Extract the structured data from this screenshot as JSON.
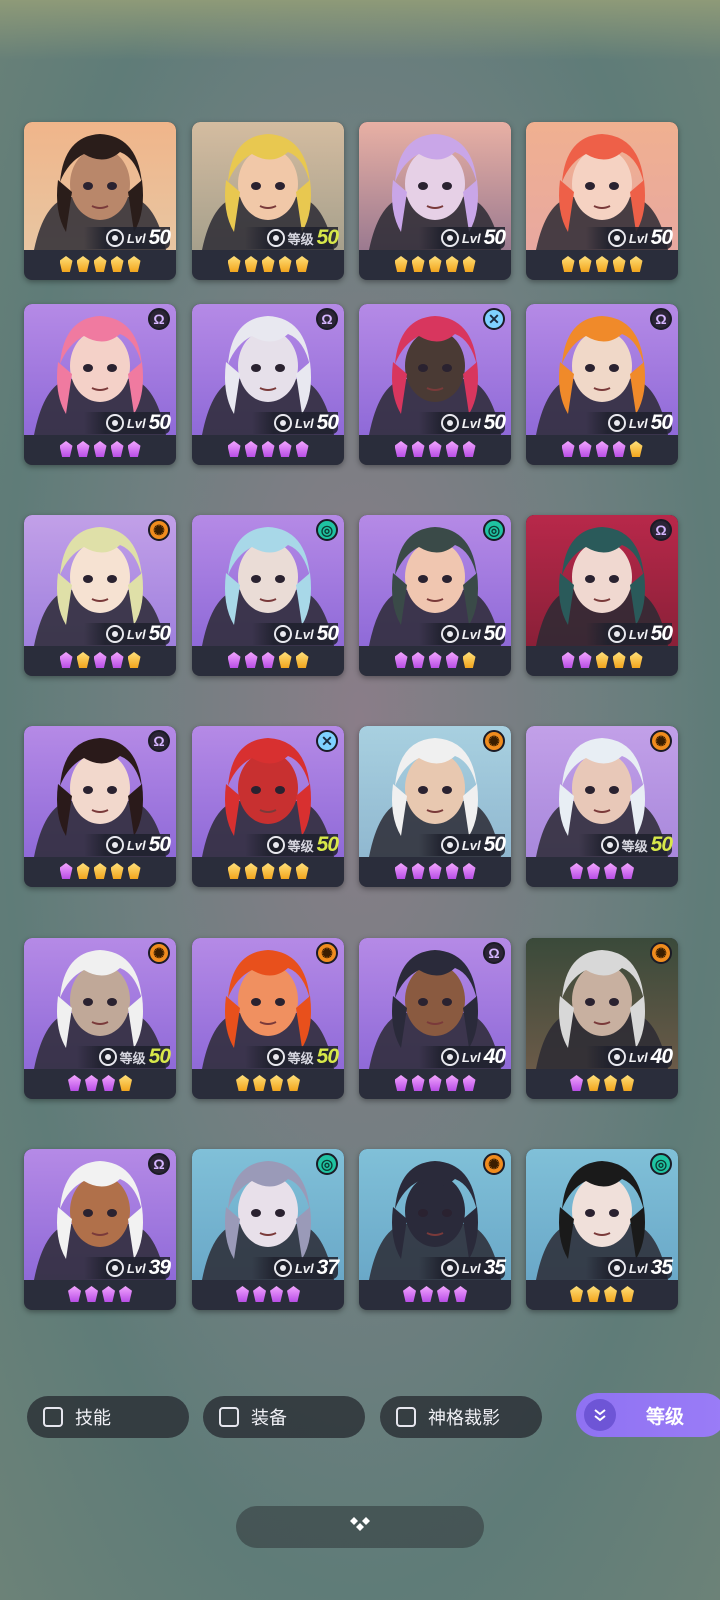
{
  "heroes": [
    {
      "lvl_prefix": "Lvl",
      "level": "50",
      "gold": false,
      "badge": "",
      "gems": [
        "gold",
        "gold",
        "gold",
        "gold",
        "gold"
      ],
      "bg": [
        "#f0b58a",
        "#e8c6a2"
      ],
      "hair": "#2a1d1a",
      "skin": "#b9876a"
    },
    {
      "lvl_prefix": "等级",
      "level": "50",
      "gold": true,
      "badge": "",
      "gems": [
        "gold",
        "gold",
        "gold",
        "gold",
        "gold"
      ],
      "bg": [
        "#d4bca0",
        "#a6a08c"
      ],
      "hair": "#e8c850",
      "skin": "#f1c8a8"
    },
    {
      "lvl_prefix": "Lvl",
      "level": "50",
      "gold": false,
      "badge": "",
      "gems": [
        "gold",
        "gold",
        "gold",
        "gold",
        "gold"
      ],
      "bg": [
        "#e8b0a4",
        "#9b7a90"
      ],
      "hair": "#c9a6e8",
      "skin": "#e6d0e6"
    },
    {
      "lvl_prefix": "Lvl",
      "level": "50",
      "gold": false,
      "badge": "",
      "gems": [
        "gold",
        "gold",
        "gold",
        "gold",
        "gold"
      ],
      "bg": [
        "#f0b090",
        "#e8a8a0"
      ],
      "hair": "#ee6048",
      "skin": "#f5d2c2"
    },
    {
      "lvl_prefix": "Lvl",
      "level": "50",
      "gold": false,
      "badge": "omega-icon",
      "gems": [
        "purple",
        "purple",
        "purple",
        "purple",
        "purple"
      ],
      "bg": [
        "#b58ae6",
        "#8f6ad8"
      ],
      "hair": "#f07aa0",
      "skin": "#f4d1c8"
    },
    {
      "lvl_prefix": "Lvl",
      "level": "50",
      "gold": false,
      "badge": "omega-icon",
      "gems": [
        "purple",
        "purple",
        "purple",
        "purple",
        "purple"
      ],
      "bg": [
        "#b58ae6",
        "#8f6ad8"
      ],
      "hair": "#e8e8f0",
      "skin": "#e6e0ea"
    },
    {
      "lvl_prefix": "Lvl",
      "level": "50",
      "gold": false,
      "badge": "x-icon",
      "gems": [
        "purple",
        "purple",
        "purple",
        "purple",
        "purple"
      ],
      "bg": [
        "#b58ae6",
        "#8f6ad8"
      ],
      "hair": "#d8365e",
      "skin": "#4a3a34"
    },
    {
      "lvl_prefix": "Lvl",
      "level": "50",
      "gold": false,
      "badge": "omega-icon",
      "gems": [
        "purple",
        "purple",
        "purple",
        "purple",
        "gold"
      ],
      "bg": [
        "#b58ae6",
        "#8f6ad8"
      ],
      "hair": "#f08a2a",
      "skin": "#f0d8c8"
    },
    {
      "lvl_prefix": "Lvl",
      "level": "50",
      "gold": false,
      "badge": "sun-icon",
      "gems": [
        "purple",
        "gold",
        "purple",
        "purple",
        "gold"
      ],
      "bg": [
        "#c2a0e8",
        "#9f80de"
      ],
      "hair": "#dfe0a8",
      "skin": "#f6e2d2"
    },
    {
      "lvl_prefix": "Lvl",
      "level": "50",
      "gold": false,
      "badge": "spiral-icon",
      "gems": [
        "purple",
        "purple",
        "purple",
        "gold",
        "gold"
      ],
      "bg": [
        "#b58ae6",
        "#8f6ad8"
      ],
      "hair": "#a8d8e8",
      "skin": "#eadcd6"
    },
    {
      "lvl_prefix": "Lvl",
      "level": "50",
      "gold": false,
      "badge": "spiral-icon",
      "gems": [
        "purple",
        "purple",
        "purple",
        "purple",
        "gold"
      ],
      "bg": [
        "#b58ae6",
        "#8f6ad8"
      ],
      "hair": "#3a4a48",
      "skin": "#f0c6b0"
    },
    {
      "lvl_prefix": "Lvl",
      "level": "50",
      "gold": false,
      "badge": "omega-icon",
      "gems": [
        "purple",
        "purple",
        "gold",
        "gold",
        "gold"
      ],
      "bg": [
        "#b8284a",
        "#8a2038"
      ],
      "hair": "#2a5a5a",
      "skin": "#f0d8d0"
    },
    {
      "lvl_prefix": "Lvl",
      "level": "50",
      "gold": false,
      "badge": "omega-icon",
      "gems": [
        "purple",
        "gold",
        "gold",
        "gold",
        "gold"
      ],
      "bg": [
        "#b58ae6",
        "#8f6ad8"
      ],
      "hair": "#2a1a1a",
      "skin": "#f2d8cc"
    },
    {
      "lvl_prefix": "等级",
      "level": "50",
      "gold": true,
      "badge": "x-icon",
      "gems": [
        "gold",
        "gold",
        "gold",
        "gold",
        "gold"
      ],
      "bg": [
        "#b58ae6",
        "#8f6ad8"
      ],
      "hair": "#d83030",
      "skin": "#c83030"
    },
    {
      "lvl_prefix": "Lvl",
      "level": "50",
      "gold": false,
      "badge": "sun-icon",
      "gems": [
        "purple",
        "purple",
        "purple",
        "purple",
        "purple"
      ],
      "bg": [
        "#a8d0e0",
        "#90b8d0"
      ],
      "hair": "#f0f0f0",
      "skin": "#e8c8b0"
    },
    {
      "lvl_prefix": "等级",
      "level": "50",
      "gold": true,
      "badge": "sun-icon",
      "gems": [
        "purple",
        "purple",
        "purple",
        "purple"
      ],
      "bg": [
        "#c2a0e8",
        "#a888dc"
      ],
      "hair": "#e8eef4",
      "skin": "#e8c8b8"
    },
    {
      "lvl_prefix": "等级",
      "level": "50",
      "gold": true,
      "badge": "sun-icon",
      "gems": [
        "purple",
        "purple",
        "purple",
        "gold"
      ],
      "bg": [
        "#b58ae6",
        "#8f6ad8"
      ],
      "hair": "#f0f0f0",
      "skin": "#c0a898"
    },
    {
      "lvl_prefix": "等级",
      "level": "50",
      "gold": true,
      "badge": "sun-icon",
      "gems": [
        "gold",
        "gold",
        "gold",
        "gold"
      ],
      "bg": [
        "#b58ae6",
        "#8f6ad8"
      ],
      "hair": "#e8501c",
      "skin": "#f09060"
    },
    {
      "lvl_prefix": "Lvl",
      "level": "40",
      "gold": false,
      "badge": "omega-icon",
      "gems": [
        "purple",
        "purple",
        "purple",
        "purple",
        "purple"
      ],
      "bg": [
        "#b58ae6",
        "#8f6ad8"
      ],
      "hair": "#2a2a3a",
      "skin": "#8a5a40"
    },
    {
      "lvl_prefix": "Lvl",
      "level": "40",
      "gold": false,
      "badge": "sun-icon",
      "gems": [
        "purple",
        "gold",
        "gold",
        "gold"
      ],
      "bg": [
        "#3a4a3a",
        "#6a5a48"
      ],
      "hair": "#d8d8d8",
      "skin": "#c8b0a0"
    },
    {
      "lvl_prefix": "Lvl",
      "level": "39",
      "gold": false,
      "badge": "omega-icon",
      "gems": [
        "purple",
        "purple",
        "purple",
        "purple"
      ],
      "bg": [
        "#b58ae6",
        "#8f6ad8"
      ],
      "hair": "#f2f2f2",
      "skin": "#b0704a"
    },
    {
      "lvl_prefix": "Lvl",
      "level": "37",
      "gold": false,
      "badge": "spiral-icon",
      "gems": [
        "purple",
        "purple",
        "purple",
        "purple"
      ],
      "bg": [
        "#80c0d8",
        "#6aa8c8"
      ],
      "hair": "#9a9ab8",
      "skin": "#e8e0ea"
    },
    {
      "lvl_prefix": "Lvl",
      "level": "35",
      "gold": false,
      "badge": "sun-icon",
      "gems": [
        "purple",
        "purple",
        "purple",
        "purple"
      ],
      "bg": [
        "#80c0d8",
        "#6aa8c8"
      ],
      "hair": "#2a2a3a",
      "skin": "#2a2a3a"
    },
    {
      "lvl_prefix": "Lvl",
      "level": "35",
      "gold": false,
      "badge": "spiral-icon",
      "gems": [
        "gold",
        "gold",
        "gold",
        "gold"
      ],
      "bg": [
        "#80c0d8",
        "#6aa8c8"
      ],
      "hair": "#1a1a1a",
      "skin": "#f0e0da"
    }
  ],
  "filters": [
    {
      "label": "技能"
    },
    {
      "label": "装备"
    },
    {
      "label": "神格裁影"
    }
  ],
  "sort": {
    "label": "等级",
    "icon": "double-chevron-down-icon"
  },
  "bottom": {
    "icon": "diamond-cluster-icon"
  }
}
